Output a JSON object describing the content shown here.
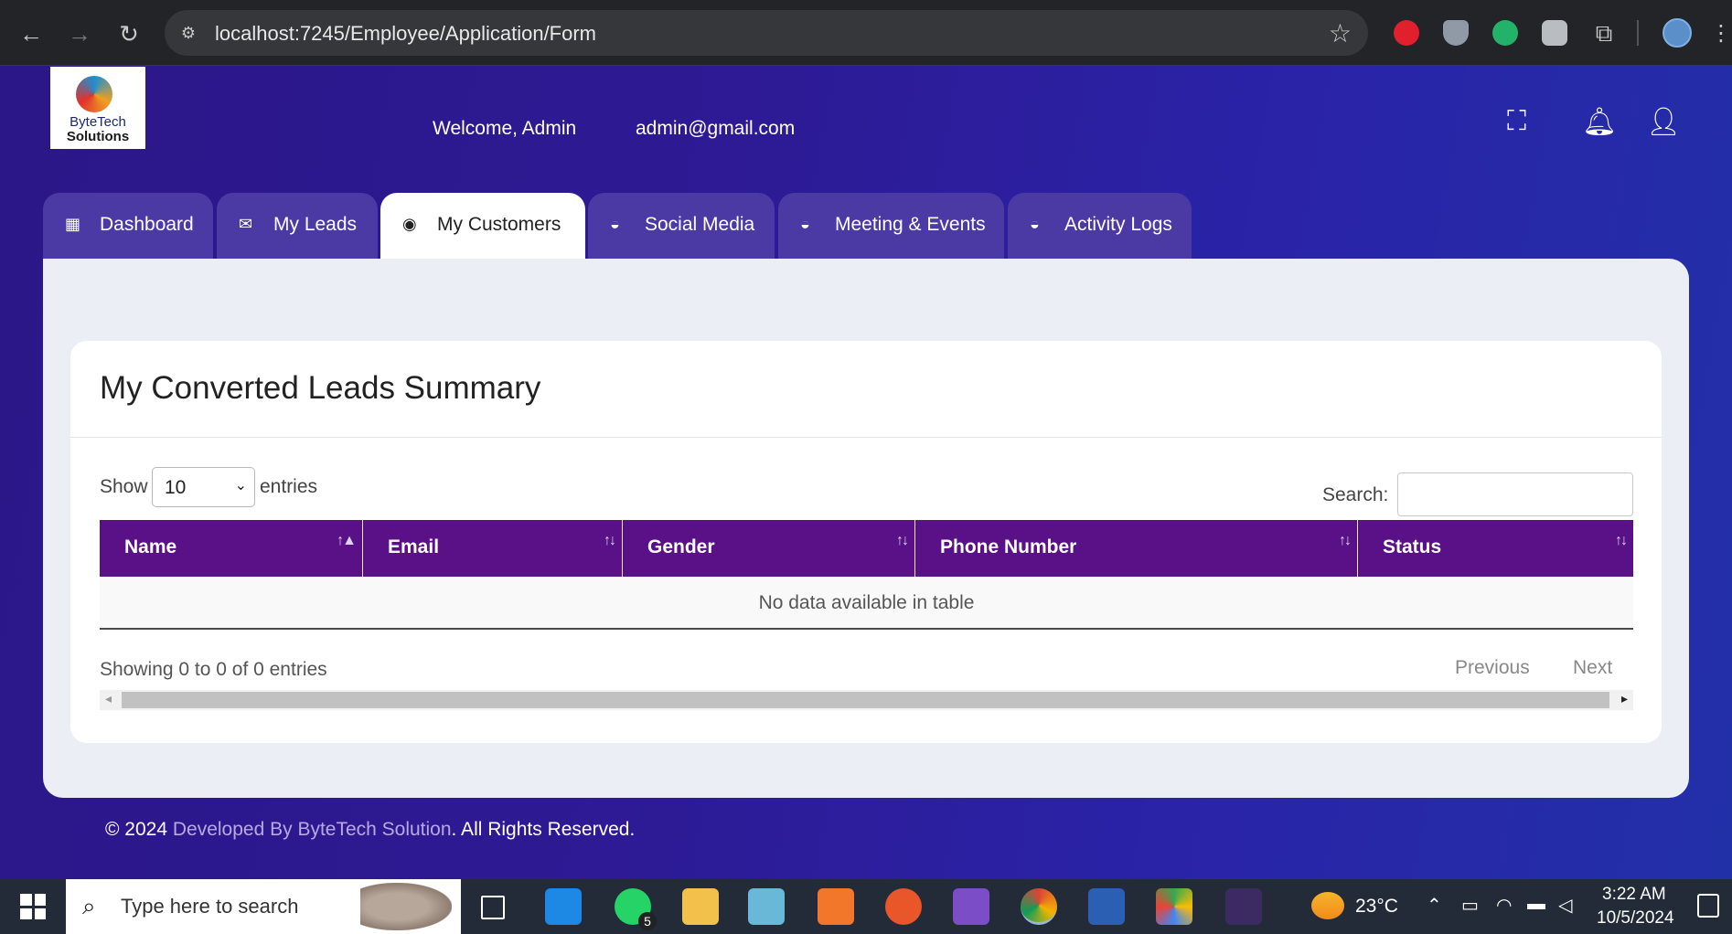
{
  "browser": {
    "url": "localhost:7245/Employee/Application/Form"
  },
  "header": {
    "logo_line1": "ByteTech",
    "logo_line2": "Solutions",
    "welcome": "Welcome, Admin",
    "email": "admin@gmail.com"
  },
  "tabs": [
    {
      "label": "Dashboard",
      "icon": "dashboard-icon"
    },
    {
      "label": "My Leads",
      "icon": "inbox-icon"
    },
    {
      "label": "My Customers",
      "icon": "customer-icon",
      "active": true
    },
    {
      "label": "Social Media",
      "icon": "basket-icon"
    },
    {
      "label": "Meeting & Events",
      "icon": "basket-icon"
    },
    {
      "label": "Activity Logs",
      "icon": "basket-icon"
    }
  ],
  "card": {
    "title": "My Converted Leads Summary",
    "show_label": "Show",
    "page_size": "10",
    "entries_label": "entries",
    "search_label": "Search:",
    "search_value": "",
    "columns": [
      "Name",
      "Email",
      "Gender",
      "Phone Number",
      "Status"
    ],
    "empty_message": "No data available in table",
    "info": "Showing 0 to 0 of 0 entries",
    "previous": "Previous",
    "next": "Next"
  },
  "footer": {
    "prefix": "© 2024 ",
    "link": "Developed By ByteTech Solution",
    "suffix": ". All Rights Reserved."
  },
  "taskbar": {
    "search_placeholder": "Type here to search",
    "whatsapp_badge": "5",
    "temperature": "23°C",
    "time": "3:22 AM",
    "date": "10/5/2024"
  },
  "colors": {
    "table_header": "#5a1188",
    "tab_inactive": "#4c3aa4",
    "page_gradient_start": "#2c1788",
    "page_gradient_end": "#2230a8"
  }
}
